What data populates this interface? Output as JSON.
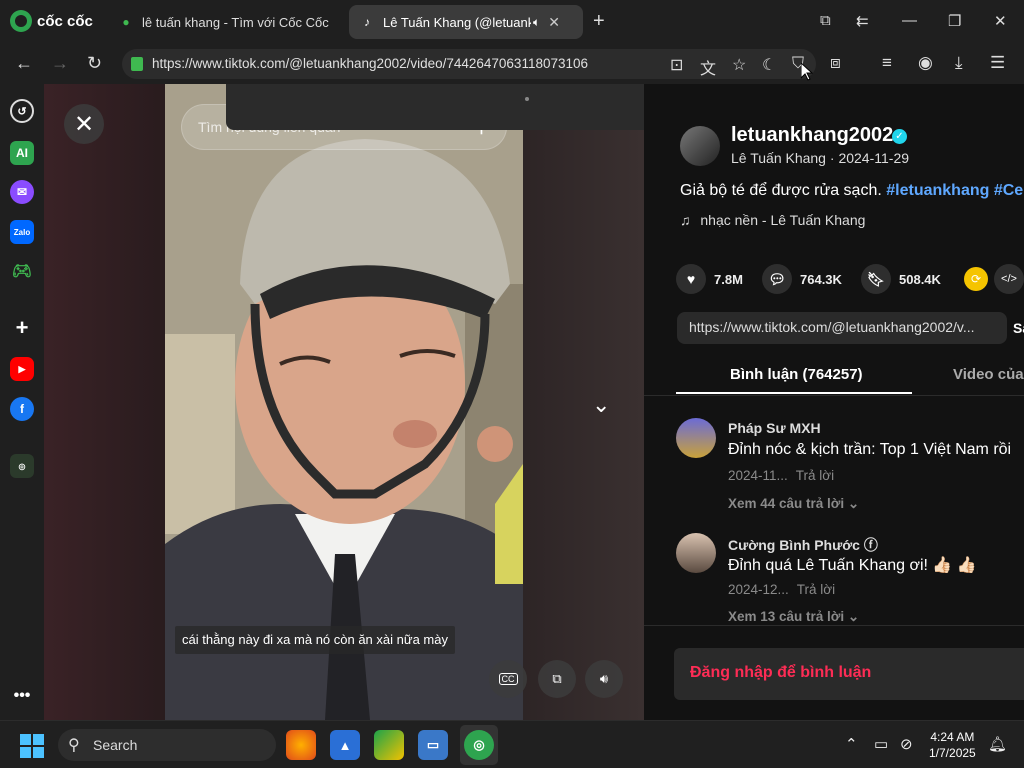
{
  "browser": {
    "brand": "cốc cốc",
    "tabs": [
      {
        "title": "lê tuấn khang - Tìm với Cốc Cốc",
        "icon": "coccoc-search-icon"
      },
      {
        "title": "Lê Tuấn Khang (@letuank",
        "icon": "tiktok-icon",
        "active": true
      }
    ],
    "url": "https://www.tiktok.com/@letuankhang2002/video/7442647063118073106"
  },
  "video": {
    "search_placeholder": "Tìm nội dung liên quan",
    "subtitle": "cái thằng này đi xa mà nó còn ăn xài nữa mày",
    "cc_label": "CC"
  },
  "post": {
    "handle": "letuankhang2002",
    "author_name": "Lê Tuấn Khang",
    "date": "2024-11-29",
    "description": "Giả bộ té để được rửa sạch.",
    "hashtags": "#letuankhang #Ce",
    "music": "nhạc nền - Lê Tuấn Khang",
    "likes": "7.8M",
    "comments": "764.3K",
    "saves": "508.4K",
    "link": "https://www.tiktok.com/@letuankhang2002/v...",
    "copy_label": "Sa",
    "tab_comments": "Bình luận (764257)",
    "tab_videos": "Video của n"
  },
  "comments": [
    {
      "name": "Pháp Sư MXH",
      "text": "Đỉnh nóc & kịch trần: Top 1 Việt Nam rồi",
      "date": "2024-11...",
      "reply": "Trả lời",
      "more": "Xem 44 câu trả lời"
    },
    {
      "name": "Cường Bình Phước ⓕ",
      "text": "Đỉnh quá Lê Tuấn Khang ơi! 👍🏻 👍🏻",
      "date": "2024-12...",
      "reply": "Trả lời",
      "more": "Xem 13 câu trả lời"
    }
  ],
  "login_prompt": "Đăng nhập để bình luận",
  "taskbar": {
    "search_label": "Search",
    "time": "4:24 AM",
    "date": "1/7/2025"
  },
  "colors": {
    "accent_red": "#fe2c55",
    "hashtag_blue": "#5fa8ff",
    "coccoc_green": "#2ea44f"
  }
}
